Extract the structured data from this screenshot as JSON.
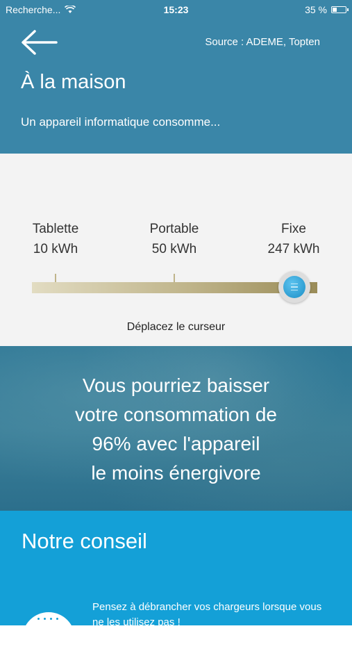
{
  "status_bar": {
    "carrier": "Recherche...",
    "time": "15:23",
    "battery": "35 %",
    "battery_level": 0.35
  },
  "header": {
    "source": "Source : ADEME, Topten",
    "title": "À la maison",
    "subtitle": "Un appareil informatique consomme..."
  },
  "slider": {
    "devices": [
      {
        "name": "Tablette",
        "value": "10 kWh"
      },
      {
        "name": "Portable",
        "value": "50 kWh"
      },
      {
        "name": "Fixe",
        "value": "247 kWh"
      }
    ],
    "selected": "Fixe",
    "hint": "Déplacez le curseur"
  },
  "result": {
    "lines": [
      "Vous pourriez baisser",
      "votre consommation de",
      "96% avec l'appareil",
      "le moins énergivore"
    ]
  },
  "advice": {
    "title": "Notre conseil",
    "text": "Pensez à débrancher vos chargeurs lorsque vous ne les utilisez pas !",
    "icon": "plug-icon"
  },
  "colors": {
    "header_bg": "#3a86a8",
    "slider_bg": "#f3f3f3",
    "advice_bg": "#14a0d7",
    "thumb": "#1a8ec6"
  }
}
